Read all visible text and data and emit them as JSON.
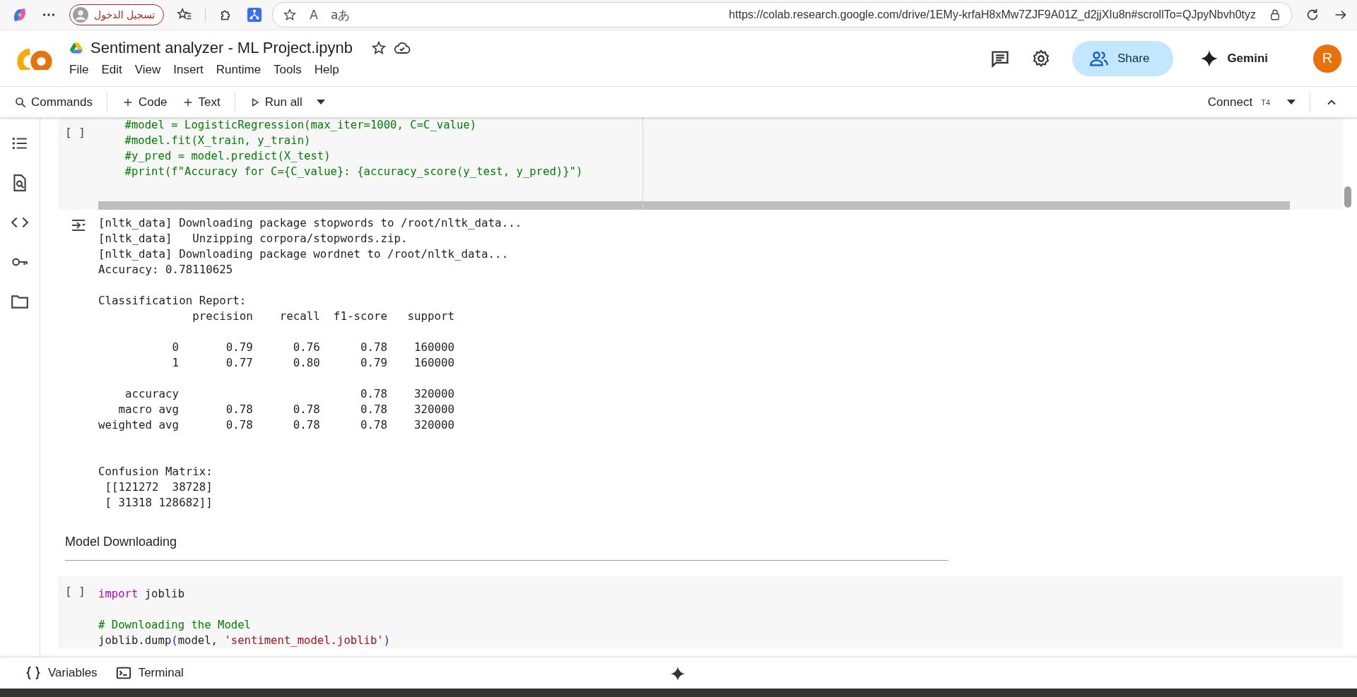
{
  "browser": {
    "profile_label": "تسجيل الدخول",
    "read_aloud_glyph": "A",
    "translate_glyph": "aあ",
    "url": "https://colab.research.google.com/drive/1EMy-krfaH8xMw7ZJF9A01Z_d2jjXIu8n#scrollTo=QJpyNbvh0tyz"
  },
  "notebook": {
    "title": "Sentiment analyzer - ML Project.ipynb",
    "menu": [
      "File",
      "Edit",
      "View",
      "Insert",
      "Runtime",
      "Tools",
      "Help"
    ]
  },
  "header_actions": {
    "share_label": "Share",
    "gemini_label": "Gemini",
    "avatar_initial": "R"
  },
  "toolbar": {
    "commands_label": "Commands",
    "add_code_label": "Code",
    "add_text_label": "Text",
    "run_all_label": "Run all",
    "connect_label": "Connect",
    "runtime_badge": "T4"
  },
  "cells": [
    {
      "kind": "code",
      "run_marker": "[ ]",
      "lines": [
        {
          "kind": "code",
          "tokens": [
            {
              "kind": "comment",
              "text": "    #model = LogisticRegression(max_iter=1000, C=C_value)"
            }
          ]
        },
        {
          "kind": "code",
          "tokens": [
            {
              "kind": "comment",
              "text": "    #model.fit(X_train, y_train)"
            }
          ]
        },
        {
          "kind": "code",
          "tokens": [
            {
              "kind": "comment",
              "text": "    #y_pred = model.predict(X_test)"
            }
          ]
        },
        {
          "kind": "code",
          "tokens": [
            {
              "kind": "comment",
              "text": "    #print(f\"Accuracy for C={C_value}: {accuracy_score(y_test, y_pred)}\")"
            }
          ]
        }
      ],
      "output": [
        {
          "kind": "text",
          "text": "[nltk_data] Downloading package stopwords to /root/nltk_data..."
        },
        {
          "kind": "text",
          "text": "[nltk_data]   Unzipping corpora/stopwords.zip."
        },
        {
          "kind": "text",
          "text": "[nltk_data] Downloading package wordnet to /root/nltk_data..."
        },
        {
          "kind": "text",
          "text": "Accuracy: 0.78110625"
        },
        {
          "kind": "blank"
        },
        {
          "kind": "text",
          "text": "Classification Report:"
        },
        {
          "kind": "text",
          "text": "              precision    recall  f1-score   support"
        },
        {
          "kind": "blank"
        },
        {
          "kind": "text",
          "text": "           0       0.79      0.76      0.78    160000"
        },
        {
          "kind": "text",
          "text": "           1       0.77      0.80      0.79    160000"
        },
        {
          "kind": "blank"
        },
        {
          "kind": "text",
          "text": "    accuracy                           0.78    320000"
        },
        {
          "kind": "text",
          "text": "   macro avg       0.78      0.78      0.78    320000"
        },
        {
          "kind": "text",
          "text": "weighted avg       0.78      0.78      0.78    320000"
        },
        {
          "kind": "blank"
        },
        {
          "kind": "blank"
        },
        {
          "kind": "text",
          "text": "Confusion Matrix:"
        },
        {
          "kind": "text",
          "text": " [[121272  38728]"
        },
        {
          "kind": "text",
          "text": " [ 31318 128682]]"
        }
      ]
    },
    {
      "kind": "text",
      "heading": "Model Downloading"
    },
    {
      "kind": "code",
      "run_marker": "[ ]",
      "lines": [
        {
          "kind": "code",
          "tokens": [
            {
              "kind": "keyword",
              "text": "import"
            },
            {
              "kind": "plain",
              "text": " joblib"
            }
          ]
        },
        {
          "kind": "blank"
        },
        {
          "kind": "code",
          "tokens": [
            {
              "kind": "comment",
              "text": "# Downloading the Model"
            }
          ]
        },
        {
          "kind": "code",
          "tokens": [
            {
              "kind": "plain",
              "text": "joblib.dump"
            },
            {
              "kind": "paren",
              "text": "("
            },
            {
              "kind": "plain",
              "text": "model, "
            },
            {
              "kind": "string",
              "text": "'sentiment_model.joblib'"
            },
            {
              "kind": "paren",
              "text": ")"
            }
          ]
        }
      ]
    }
  ],
  "bottom_bar": {
    "variables_label": "Variables",
    "terminal_label": "Terminal"
  }
}
